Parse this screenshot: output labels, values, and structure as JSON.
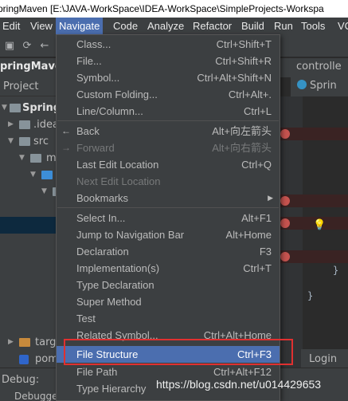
{
  "window": {
    "title": "pringMaven [E:\\JAVA-WorkSpace\\IDEA-WorkSpace\\SimpleProjects-Workspa"
  },
  "menubar": {
    "items": [
      "Edit",
      "View",
      "Navigate",
      "Code",
      "Analyze",
      "Refactor",
      "Build",
      "Run",
      "Tools",
      "VC"
    ]
  },
  "navbar": {
    "project": "pringMaven",
    "crumb": "controlle"
  },
  "project_panel": {
    "label": "Project"
  },
  "tree": {
    "items": [
      "SpringM",
      ".idea",
      "src",
      "m",
      "",
      "",
      "",
      "",
      "targ",
      "pom"
    ]
  },
  "editor": {
    "tab": "Sprin",
    "code": [
      "}",
      "}"
    ]
  },
  "navigate_menu": {
    "items": [
      {
        "label": "Class...",
        "shortcut": "Ctrl+Shift+T"
      },
      {
        "label": "File...",
        "shortcut": "Ctrl+Shift+R"
      },
      {
        "label": "Symbol...",
        "shortcut": "Ctrl+Alt+Shift+N"
      },
      {
        "label": "Custom Folding...",
        "shortcut": "Ctrl+Alt+."
      },
      {
        "label": "Line/Column...",
        "shortcut": "Ctrl+L"
      },
      {
        "label": "Back",
        "shortcut": "Alt+向左箭头"
      },
      {
        "label": "Forward",
        "shortcut": "Alt+向右箭头"
      },
      {
        "label": "Last Edit Location",
        "shortcut": "Ctrl+Q"
      },
      {
        "label": "Next Edit Location",
        "shortcut": ""
      },
      {
        "label": "Bookmarks",
        "shortcut": ""
      },
      {
        "label": "Select In...",
        "shortcut": "Alt+F1"
      },
      {
        "label": "Jump to Navigation Bar",
        "shortcut": "Alt+Home"
      },
      {
        "label": "Declaration",
        "shortcut": "F3"
      },
      {
        "label": "Implementation(s)",
        "shortcut": "Ctrl+T"
      },
      {
        "label": "Type Declaration",
        "shortcut": ""
      },
      {
        "label": "Super Method",
        "shortcut": ""
      },
      {
        "label": "Test",
        "shortcut": ""
      },
      {
        "label": "Related Symbol...",
        "shortcut": "Ctrl+Alt+Home"
      },
      {
        "label": "File Structure",
        "shortcut": "Ctrl+F3"
      },
      {
        "label": "File Path",
        "shortcut": "Ctrl+Alt+F12"
      },
      {
        "label": "Type Hierarchy",
        "shortcut": ""
      }
    ]
  },
  "bottom": {
    "debug_label": "Debug:",
    "debugger_tab": "Debugge",
    "login_tab": "Login"
  },
  "watermark": "https://blog.csdn.net/u014429653",
  "colors": {
    "menu_bg": "#3c3f41",
    "highlight": "#4b6eaf",
    "annotation": "#e03030",
    "breakpoint": "#c75450"
  }
}
